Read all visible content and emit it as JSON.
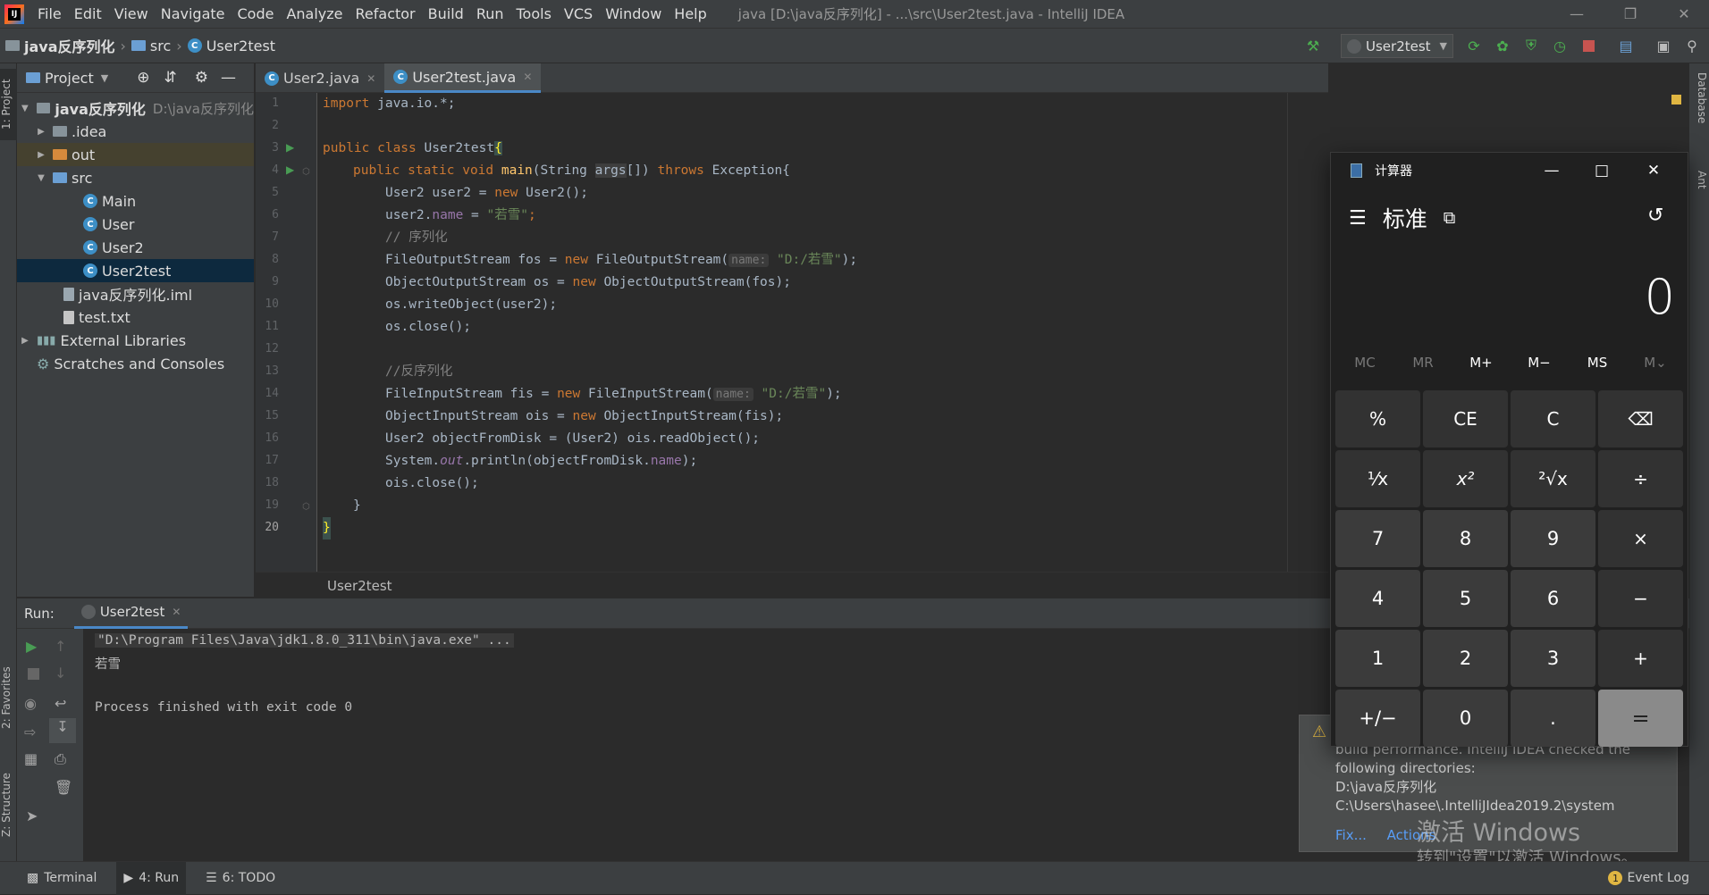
{
  "menubar": {
    "items": [
      "File",
      "Edit",
      "View",
      "Navigate",
      "Code",
      "Analyze",
      "Refactor",
      "Build",
      "Run",
      "Tools",
      "VCS",
      "Window",
      "Help"
    ],
    "window_title": "java [D:\\java反序列化] - ...\\src\\User2test.java - IntelliJ IDEA"
  },
  "navbar": {
    "crumbs": [
      "java反序列化",
      "src",
      "User2test"
    ],
    "run_config": "User2test"
  },
  "left_strip": {
    "project": "1: Project",
    "favorites": "2: Favorites",
    "structure": "Z: Structure"
  },
  "right_strip": {
    "database": "Database",
    "ant": "Ant"
  },
  "project": {
    "header": "Project",
    "root": {
      "label": "java反序列化",
      "path": "D:\\java反序列化"
    },
    "items": [
      ".idea",
      "out",
      "src",
      "Main",
      "User",
      "User2",
      "User2test",
      "java反序列化.iml",
      "test.txt",
      "External Libraries",
      "Scratches and Consoles"
    ]
  },
  "editor": {
    "tabs": [
      "User2.java",
      "User2test.java"
    ],
    "line_numbers": [
      "1",
      "2",
      "3",
      "4",
      "5",
      "6",
      "7",
      "8",
      "9",
      "10",
      "11",
      "12",
      "13",
      "14",
      "15",
      "16",
      "17",
      "18",
      "19",
      "20"
    ],
    "breadcrumb": "User2test",
    "code": {
      "l1_kw": "import",
      "l1_rest": " java.io.*;",
      "l3_kw": "public class",
      "l3_name": " User2test",
      "l3_brace": "{",
      "l4_kw1": "public static void",
      "l4_fn": " main",
      "l4_a": "(String ",
      "l4_arg": "args",
      "l4_b": "[]) ",
      "l4_kw2": "throws",
      "l4_c": " Exception{",
      "l5_a": "User2 user2 = ",
      "l5_kw": "new",
      "l5_b": " User2();",
      "l6_a": "user2.",
      "l6_f": "name",
      "l6_b": " = ",
      "l6_s": "\"若雪\"",
      "l6_c": ";",
      "l7_cm": "// 序列化",
      "l8_a": "FileOutputStream fos = ",
      "l8_kw": "new",
      "l8_b": " FileOutputStream(",
      "l8_hint": "name:",
      "l8_s": " \"D:/若雪\"",
      "l8_c": ");",
      "l9_a": "ObjectOutputStream os = ",
      "l9_kw": "new",
      "l9_b": " ObjectOutputStream(fos);",
      "l10": "os.writeObject(user2);",
      "l11": "os.close();",
      "l13_cm": "//反序列化",
      "l14_a": "FileInputStream fis = ",
      "l14_kw": "new",
      "l14_b": " FileInputStream(",
      "l14_hint": "name:",
      "l14_s": " \"D:/若雪\"",
      "l14_c": ");",
      "l15_a": "ObjectInputStream ois = ",
      "l15_kw": "new",
      "l15_b": " ObjectInputStream(fis);",
      "l16": "User2 objectFromDisk = (User2) ois.readObject();",
      "l17_a": "System.",
      "l17_f": "out",
      "l17_b": ".println(objectFromDisk.",
      "l17_f2": "name",
      "l17_c": ");",
      "l18": "ois.close();",
      "l19": "}",
      "l20": "}"
    }
  },
  "run": {
    "label": "Run:",
    "tab": "User2test",
    "output": [
      "\"D:\\Program Files\\Java\\jdk1.8.0_311\\bin\\java.exe\" ...",
      "若雪",
      "",
      "Process finished with exit code 0"
    ]
  },
  "notification": {
    "lines": [
      "build performance. IntelliJ IDEA checked the",
      "following directories:",
      "D:\\java反序列化",
      "C:\\Users\\hasee\\.IntelliJIdea2019.2\\system"
    ],
    "fix": "Fix...",
    "actions": "Actions"
  },
  "watermark": {
    "line1": "激活 Windows",
    "line2": "转到\"设置\"以激活 Windows。"
  },
  "statusbar": {
    "terminal": "Terminal",
    "run": "4: Run",
    "todo": "6: TODO",
    "event_log": "Event Log",
    "event_count": "1"
  },
  "calculator": {
    "title": "计算器",
    "mode": "标准",
    "display": "0",
    "memory": [
      "MC",
      "MR",
      "M+",
      "M−",
      "MS",
      "M⌄"
    ],
    "keys": [
      "%",
      "CE",
      "C",
      "⌫",
      "¹⁄x",
      "x²",
      "²√x",
      "÷",
      "7",
      "8",
      "9",
      "×",
      "4",
      "5",
      "6",
      "−",
      "1",
      "2",
      "3",
      "+",
      "+/−",
      "0",
      ".",
      "="
    ]
  },
  "colors": {
    "accent": "#4a88c7",
    "keyword": "#cc7832",
    "string": "#6a8759",
    "field": "#9876aa"
  }
}
